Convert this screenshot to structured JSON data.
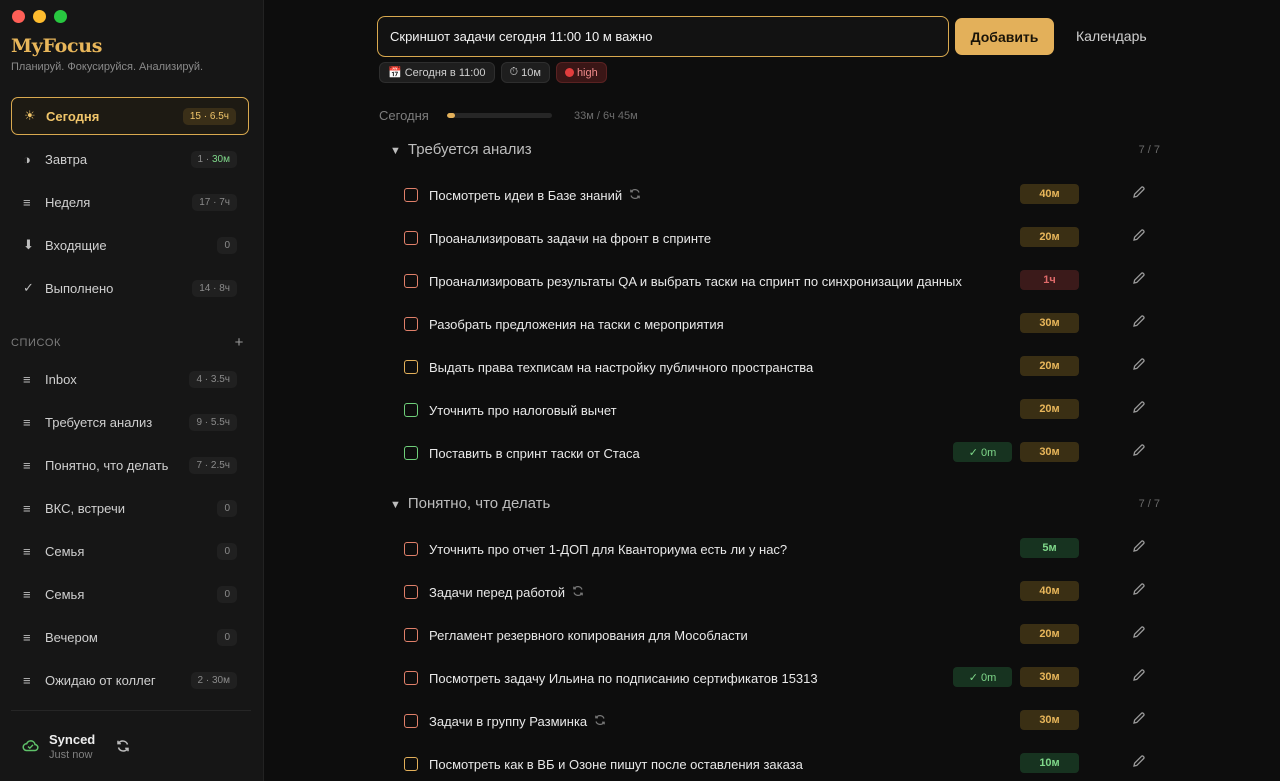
{
  "app": {
    "name": "MyFocus",
    "tagline": "Планируй. Фокусируйся. Анализируй."
  },
  "nav": [
    {
      "icon": "sun-icon",
      "glyph": "☀",
      "label": "Сегодня",
      "count": "15 · 6.5ч",
      "active": true
    },
    {
      "icon": "half-moon-icon",
      "glyph": "◑",
      "label": "Завтра",
      "count_a": "1 · ",
      "count_b": "30м"
    },
    {
      "icon": "list-icon",
      "glyph": "≡",
      "label": "Неделя",
      "count": "17 · 7ч"
    },
    {
      "icon": "inbox-arrow-icon",
      "glyph": "⬇",
      "label": "Входящие",
      "count": "0"
    },
    {
      "icon": "check-icon",
      "glyph": "✓",
      "label": "Выполнено",
      "count": "14 · 8ч"
    }
  ],
  "lists_section": {
    "title": "СПИСОК",
    "add": "+"
  },
  "lists": [
    {
      "label": "Inbox",
      "count": "4 · 3.5ч"
    },
    {
      "label": "Требуется анализ",
      "count": "9 · 5.5ч"
    },
    {
      "label": "Понятно, что делать",
      "count": "7 · 2.5ч"
    },
    {
      "label": "ВКС, встречи",
      "count": "0"
    },
    {
      "label": "Семья",
      "count": "0"
    },
    {
      "label": "Семья",
      "count": "0"
    },
    {
      "label": "Вечером",
      "count": "0"
    },
    {
      "label": "Ожидаю от коллег",
      "count": "2 · 30м"
    }
  ],
  "sync": {
    "title": "Synced",
    "subtitle": "Just now"
  },
  "input": {
    "value": "Скриншот задачи сегодня 11:00 10 м важно"
  },
  "add_button": "Добавить",
  "calendar_link": "Календарь",
  "chips": {
    "date": "Сегодня в 11:00",
    "duration": "10м",
    "priority": "high"
  },
  "progress": {
    "label": "Сегодня",
    "text": "33м / 6ч 45м",
    "fraction": 0.08
  },
  "groups": [
    {
      "title": "Требуется анализ",
      "count": "7 / 7",
      "tasks": [
        {
          "title": "Посмотреть идеи в Базе знаний",
          "repeat": true,
          "est": "40м",
          "est_color": "amber",
          "cb": "orange"
        },
        {
          "title": "Проанализировать задачи на фронт в спринте",
          "est": "20м",
          "est_color": "amber",
          "cb": "orange"
        },
        {
          "title": "Проанализировать результаты QA и выбрать таски на спринт по синхронизации данных",
          "est": "1ч",
          "est_color": "red",
          "cb": "orange"
        },
        {
          "title": "Разобрать предложения на таски с мероприятия",
          "est": "30м",
          "est_color": "amber",
          "cb": "orange"
        },
        {
          "title": "Выдать права техписам на настройку публичного пространства",
          "est": "20м",
          "est_color": "amber",
          "cb": "amber"
        },
        {
          "title": "Уточнить про налоговый вычет",
          "est": "20м",
          "est_color": "amber",
          "cb": "green"
        },
        {
          "title": "Поставить в спринт таски от Стаса",
          "done": "✓ 0m",
          "est": "30м",
          "est_color": "amber",
          "cb": "green"
        }
      ]
    },
    {
      "title": "Понятно, что делать",
      "count": "7 / 7",
      "tasks": [
        {
          "title": "Уточнить про отчет 1-ДОП для Кванториума есть ли у нас?",
          "est": "5м",
          "est_color": "green",
          "cb": "orange"
        },
        {
          "title": "Задачи перед работой",
          "repeat": true,
          "est": "40м",
          "est_color": "amber",
          "cb": "orange"
        },
        {
          "title": "Регламент резервного копирования для Мособласти",
          "est": "20м",
          "est_color": "amber",
          "cb": "orange"
        },
        {
          "title": "Посмотреть задачу Ильина по подписанию сертификатов 15313",
          "done": "✓ 0m",
          "est": "30м",
          "est_color": "amber",
          "cb": "orange"
        },
        {
          "title": "Задачи в группу Разминка",
          "repeat": true,
          "est": "30м",
          "est_color": "amber",
          "cb": "orange"
        },
        {
          "title": "Посмотреть как в ВБ и Озоне пишут после оставления заказа",
          "est": "10м",
          "est_color": "green",
          "cb": "amber"
        }
      ]
    }
  ],
  "colors": {
    "accent": "#e3b05a",
    "background": "#0d0d0d",
    "sidebar": "#161616"
  }
}
